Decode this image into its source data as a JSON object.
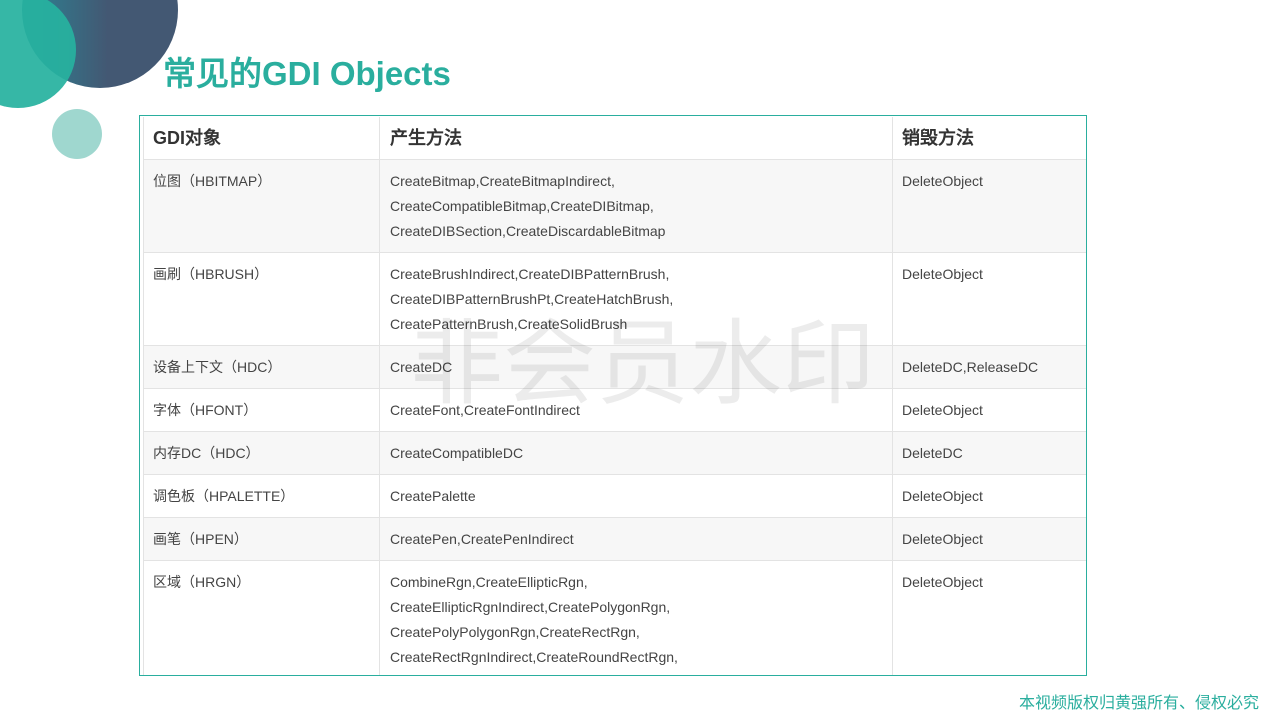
{
  "title": "常见的GDI Objects",
  "watermark": "非会员水印",
  "copyright": "本视频版权归黄强所有、侵权必究",
  "colors": {
    "accent": "#2aae9e",
    "decor-dark": "#435873",
    "decor-dark-edge": "#2b8494",
    "decor-teal": "#27b29f",
    "decor-light": "#9fd7cf",
    "row-alt": "#f7f7f7",
    "grid": "#e3e3e3",
    "text": "#444444"
  },
  "table": {
    "headers": [
      "GDI对象",
      "产生方法",
      "销毁方法"
    ],
    "rows": [
      {
        "object": "位图（HBITMAP）",
        "create": [
          "CreateBitmap,CreateBitmapIndirect,",
          "CreateCompatibleBitmap,CreateDIBitmap,",
          "CreateDIBSection,CreateDiscardableBitmap"
        ],
        "destroy": "DeleteObject"
      },
      {
        "object": "画刷（HBRUSH）",
        "create": [
          "CreateBrushIndirect,CreateDIBPatternBrush,",
          "CreateDIBPatternBrushPt,CreateHatchBrush,",
          "CreatePatternBrush,CreateSolidBrush"
        ],
        "destroy": "DeleteObject"
      },
      {
        "object": "设备上下文（HDC）",
        "create": [
          "CreateDC"
        ],
        "destroy": "DeleteDC,ReleaseDC"
      },
      {
        "object": "字体（HFONT）",
        "create": [
          "CreateFont,CreateFontIndirect"
        ],
        "destroy": "DeleteObject"
      },
      {
        "object": "内存DC（HDC）",
        "create": [
          "CreateCompatibleDC"
        ],
        "destroy": "DeleteDC"
      },
      {
        "object": "调色板（HPALETTE）",
        "create": [
          "CreatePalette"
        ],
        "destroy": "DeleteObject"
      },
      {
        "object": "画笔（HPEN）",
        "create": [
          "CreatePen,CreatePenIndirect"
        ],
        "destroy": "DeleteObject"
      },
      {
        "object": "区域（HRGN）",
        "create": [
          "CombineRgn,CreateEllipticRgn,",
          "CreateEllipticRgnIndirect,CreatePolygonRgn,",
          "CreatePolyPolygonRgn,CreateRectRgn,",
          "CreateRectRgnIndirect,CreateRoundRectRgn,"
        ],
        "destroy": "DeleteObject"
      }
    ]
  }
}
